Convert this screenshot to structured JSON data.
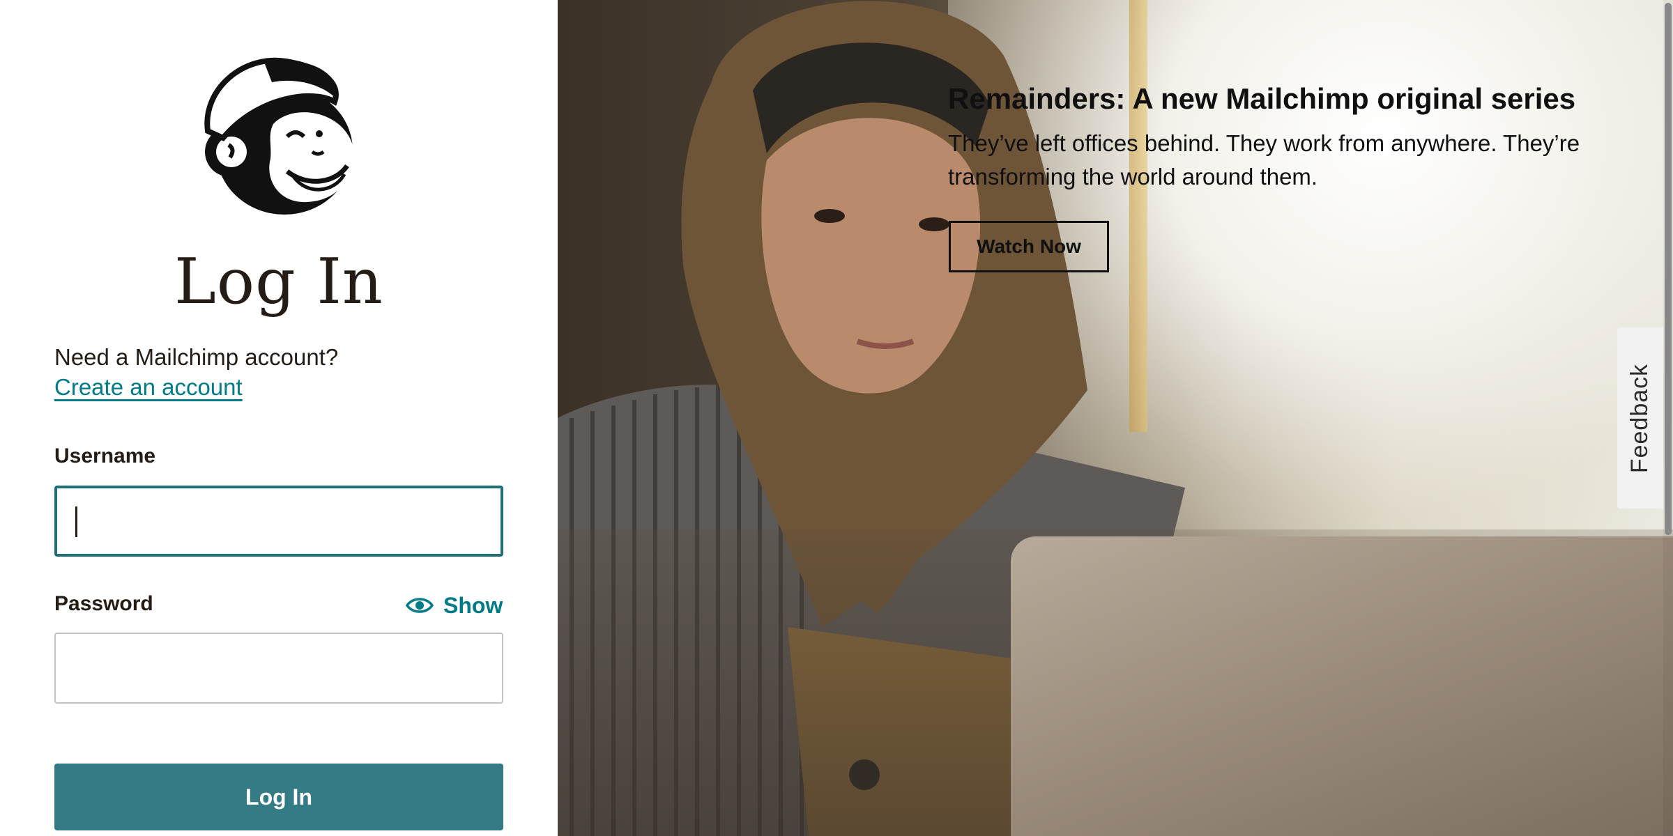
{
  "login": {
    "title": "Log In",
    "need_account": "Need a Mailchimp account?",
    "create_account_link": "Create an account",
    "username_label": "Username",
    "username_value": "",
    "password_label": "Password",
    "password_value": "",
    "show_toggle_label": "Show",
    "show_toggle_icon": "eye-icon",
    "submit_label": "Log In"
  },
  "hero": {
    "title": "Remainders: A new Mailchimp original series",
    "description": "They’ve left offices behind. They work from anywhere. They’re transforming the world around them.",
    "button_label": "Watch Now"
  },
  "feedback": {
    "label": "Feedback"
  },
  "colors": {
    "accent": "#007c89",
    "button_bg": "#357b85",
    "text": "#241c15",
    "focus_border": "#1f6f78"
  },
  "icons": {
    "logo": "mailchimp-freddie-logo",
    "show": "eye-icon"
  }
}
